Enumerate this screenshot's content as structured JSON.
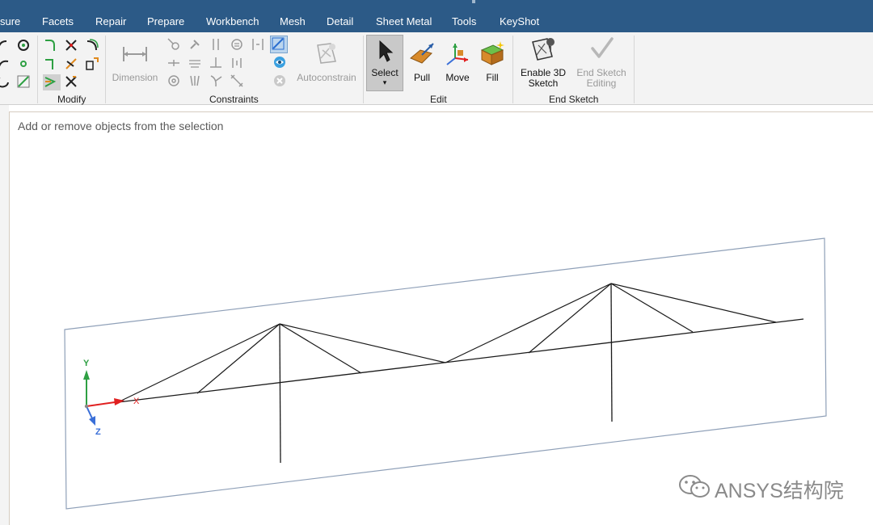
{
  "menu": {
    "tabs": [
      "sure",
      "Facets",
      "Repair",
      "Prepare",
      "Workbench",
      "Mesh",
      "Detail",
      "Sheet Metal",
      "Tools",
      "KeyShot"
    ]
  },
  "ribbon": {
    "groups": {
      "modify": "Modify",
      "constraints": "Constraints",
      "edit": "Edit",
      "end_sketch": "End Sketch"
    },
    "buttons": {
      "dimension": "Dimension",
      "autoconstrain": "Autoconstrain",
      "select": "Select",
      "pull": "Pull",
      "move": "Move",
      "fill": "Fill",
      "enable_3d_sketch_line1": "Enable 3D",
      "enable_3d_sketch_line2": "Sketch",
      "end_sketch_editing_line1": "End Sketch",
      "end_sketch_editing_line2": "Editing"
    }
  },
  "canvas": {
    "hint": "Add or remove objects from the selection",
    "triad": {
      "y": "Y",
      "x": "X",
      "z": "Z"
    }
  },
  "watermark": "ANSYS结构院",
  "colors": {
    "menubar": "#2c5a87",
    "ribbon": "#f3f3f3",
    "axis_x": "#e02020",
    "axis_y": "#2ea043",
    "axis_z": "#3a6fd8",
    "sketch_plane": "#8fa0b8"
  }
}
